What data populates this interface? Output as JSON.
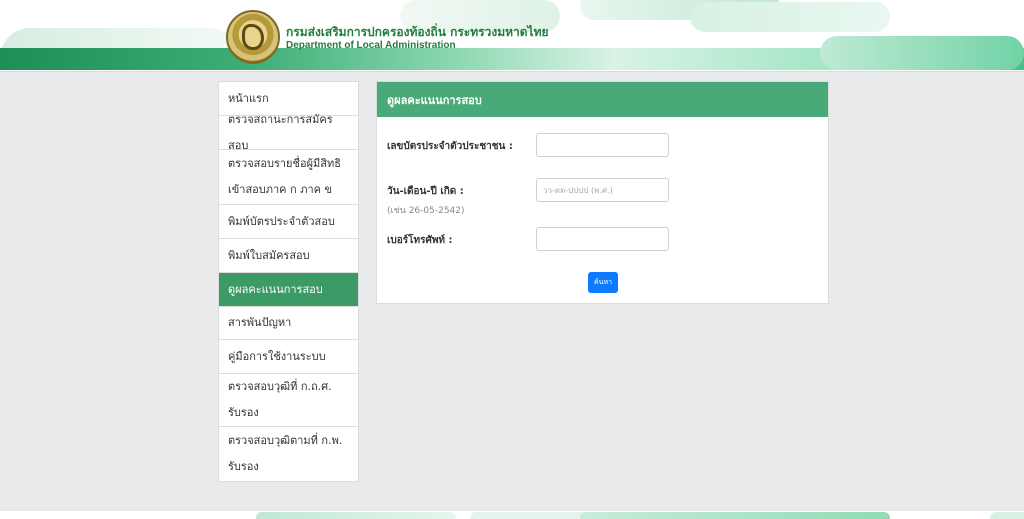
{
  "header": {
    "org_name_th": "กรมส่งเสริมการปกครองท้องถิ่น กระทรวงมหาดไทย",
    "org_name_en": "Department of Local Administration"
  },
  "sidebar": {
    "items": [
      {
        "label": "หน้าแรก",
        "active": false
      },
      {
        "label": "ตรวจสถานะการสมัครสอบ",
        "active": false
      },
      {
        "label": "ตรวจสอบรายชื่อผู้มีสิทธิเข้าสอบภาค ก ภาค ข",
        "active": false
      },
      {
        "label": "พิมพ์บัตรประจำตัวสอบ",
        "active": false
      },
      {
        "label": "พิมพ์ใบสมัครสอบ",
        "active": false
      },
      {
        "label": "ดูผลคะแนนการสอบ",
        "active": true
      },
      {
        "label": "สารพันปัญหา",
        "active": false
      },
      {
        "label": "คู่มือการใช้งานระบบ",
        "active": false
      },
      {
        "label": "ตรวจสอบวุฒิที่ ก.ถ.ศ. รับรอง",
        "active": false
      },
      {
        "label": "ตรวจสอบวุฒิตามที่ ก.พ. รับรอง",
        "active": false
      }
    ]
  },
  "form": {
    "title": "ดูผลคะแนนการสอบ",
    "id_label": "เลขบัตรประจำตัวประชาชน :",
    "id_value": "",
    "dob_label": "วัน-เดือน-ปี เกิด :",
    "dob_hint": "(เช่น 26-05-2542)",
    "dob_placeholder": "วว-ดด-ปปปป (พ.ศ.)",
    "phone_label": "เบอร์โทรศัพท์ :",
    "phone_value": "",
    "search_label": "ค้นหา"
  },
  "colors": {
    "brand_green": "#3c9a67",
    "card_header": "#4aa979",
    "button_blue": "#0d7bff"
  }
}
